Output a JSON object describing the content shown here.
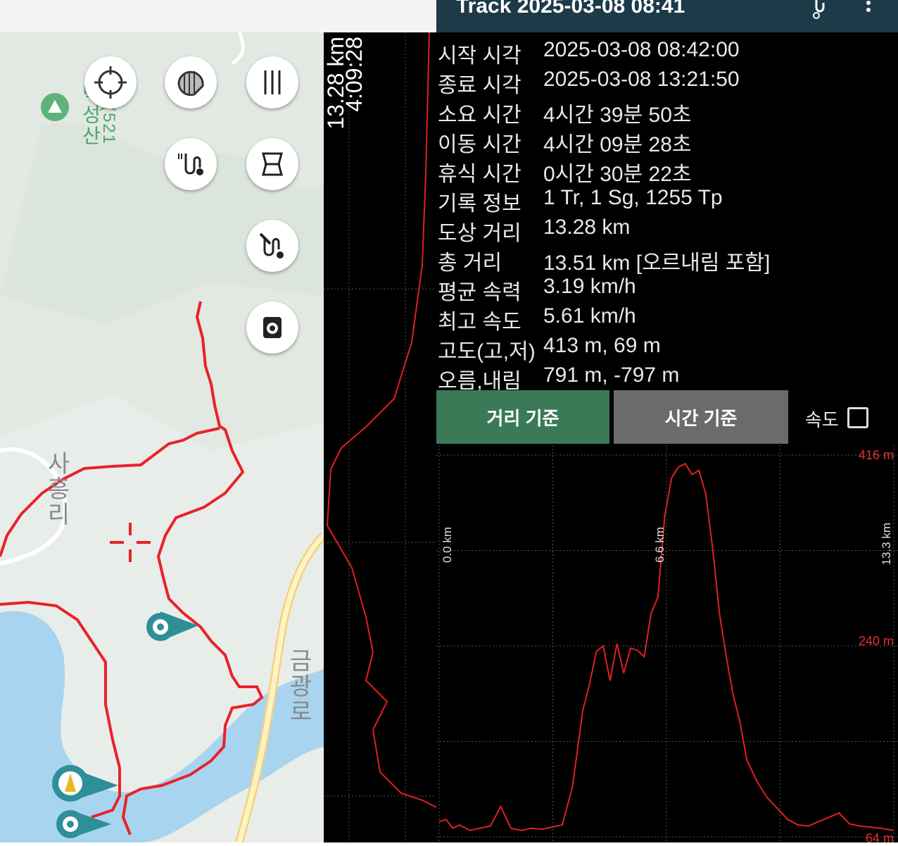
{
  "header": {
    "title": "Track 2025-03-08 08:41"
  },
  "map": {
    "labels": {
      "peak": "덕성산",
      "peak_alt": "(521",
      "village": "사흥리",
      "road": "금광로"
    },
    "buttons": [
      {
        "name": "locate-button",
        "icon": "crosshair-icon"
      },
      {
        "name": "layer-button",
        "icon": "map-layer-icon"
      },
      {
        "name": "menu-button",
        "icon": "bars-icon"
      },
      {
        "name": "track-list-button",
        "icon": "route-icon"
      },
      {
        "name": "map-scroll-button",
        "icon": "scroll-icon"
      },
      {
        "name": "route-edit-button",
        "icon": "route-edit-icon"
      },
      {
        "name": "camera-button",
        "icon": "camera-icon"
      }
    ]
  },
  "vstrip": {
    "distance": "13.28 km",
    "duration": "4:09:28"
  },
  "info": {
    "rows": [
      {
        "key": "시작 시각",
        "value": "2025-03-08 08:42:00"
      },
      {
        "key": "종료 시각",
        "value": "2025-03-08 13:21:50"
      },
      {
        "key": "소요 시간",
        "value": "4시간 39분 50초"
      },
      {
        "key": "이동 시간",
        "value": "4시간 09분 28초"
      },
      {
        "key": "휴식 시간",
        "value": "0시간 30분 22초"
      },
      {
        "key": "기록 정보",
        "value": "1 Tr, 1 Sg, 1255 Tp"
      },
      {
        "key": "도상 거리",
        "value": "13.28 km"
      },
      {
        "key": "총 거리",
        "value": "13.51 km [오르내림 포함]"
      },
      {
        "key": "평균 속력",
        "value": "3.19 km/h"
      },
      {
        "key": "최고 속도",
        "value": "5.61 km/h"
      },
      {
        "key": "고도(고,저)",
        "value": "413 m, 69 m"
      },
      {
        "key": "오름,내림",
        "value": "791 m, -797 m"
      }
    ]
  },
  "controls": {
    "distance_button": "거리 기준",
    "time_button": "시간 기준",
    "speed_label": "속도",
    "speed_checked": false,
    "active_color": "#3a7a57",
    "inactive_color": "#6b6b6b"
  },
  "chart_data": {
    "type": "line",
    "title": "",
    "xlabel": "",
    "ylabel": "",
    "x_unit": "km",
    "y_unit": "m",
    "ylim": [
      64,
      416
    ],
    "y_tick_labels": [
      "416 m",
      "240 m",
      "64 m"
    ],
    "x_tick_labels": [
      "0.0 km",
      "6.6 km",
      "13.3 km"
    ],
    "xlim": [
      0,
      13.3
    ],
    "line_color": "#e02020",
    "series": [
      {
        "x": [
          0,
          0.2,
          0.4,
          0.6,
          0.9,
          1.2,
          1.5,
          1.8,
          2.1,
          2.4,
          2.7,
          3.0,
          3.3,
          3.6,
          3.9,
          4.2,
          4.4,
          4.6,
          4.8,
          5.0,
          5.2,
          5.4,
          5.6,
          5.8,
          6.0,
          6.2,
          6.4,
          6.6,
          6.8,
          7.0,
          7.2,
          7.4,
          7.6,
          7.8,
          8.0,
          8.2,
          8.4,
          8.6,
          8.8,
          9.0,
          9.3,
          9.6,
          9.9,
          10.2,
          10.5,
          10.8,
          11.1,
          11.4,
          11.7,
          12.0,
          12.3,
          12.6,
          12.9,
          13.3
        ],
        "y": [
          78,
          80,
          72,
          75,
          70,
          72,
          74,
          92,
          72,
          70,
          72,
          71,
          73,
          75,
          110,
          180,
          205,
          235,
          240,
          208,
          242,
          215,
          238,
          236,
          230,
          270,
          285,
          360,
          395,
          405,
          408,
          398,
          402,
          380,
          330,
          270,
          230,
          195,
          170,
          135,
          115,
          100,
          90,
          80,
          75,
          74,
          78,
          82,
          86,
          76,
          74,
          73,
          72,
          70
        ]
      }
    ]
  }
}
